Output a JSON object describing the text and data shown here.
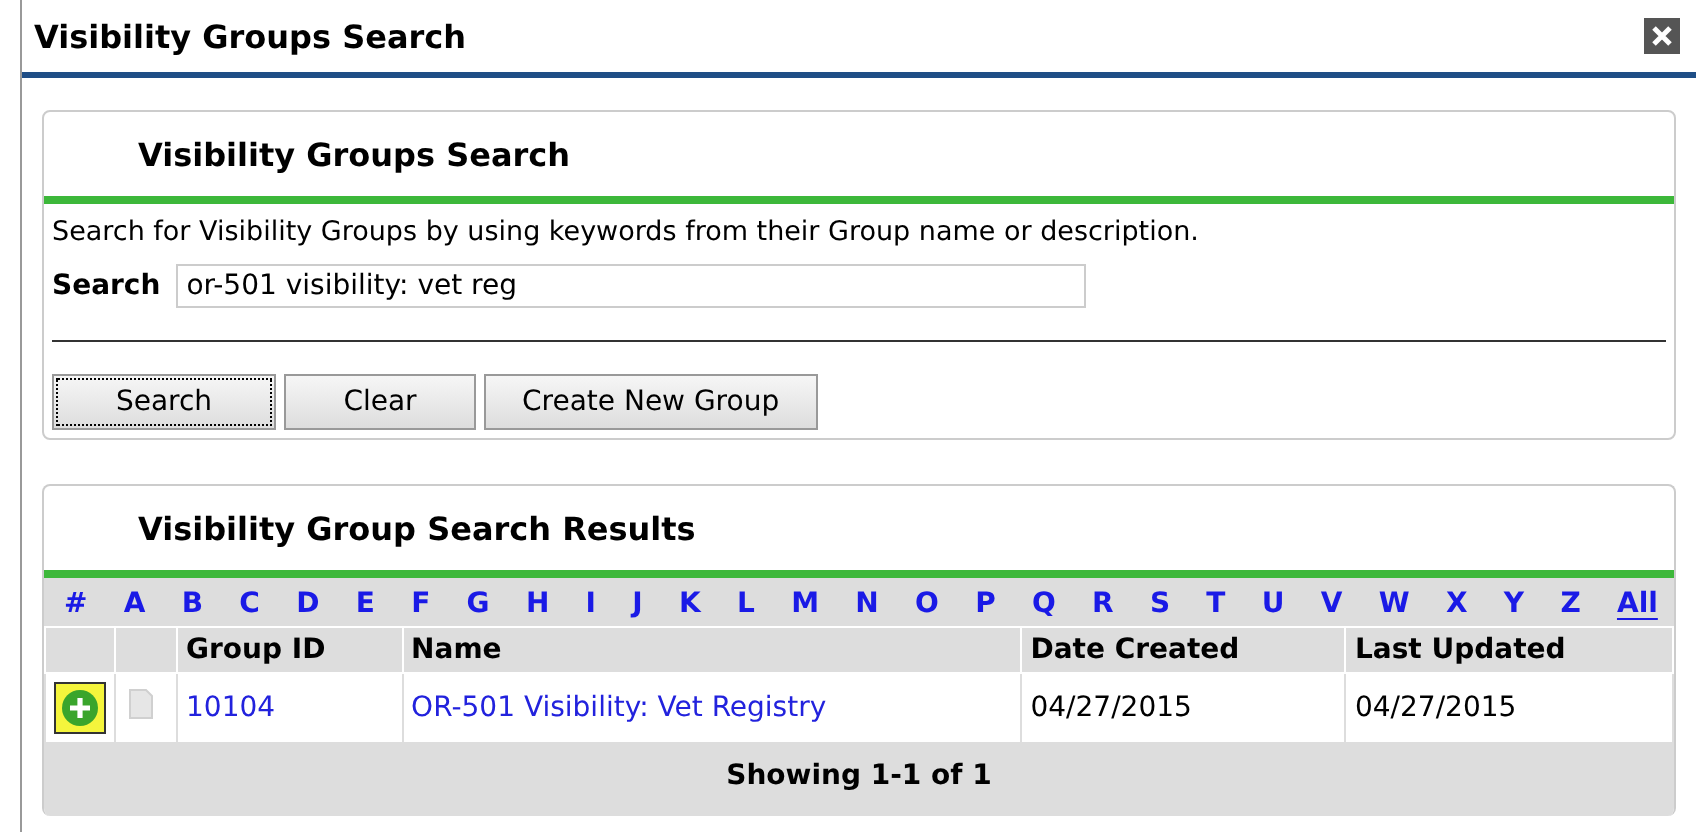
{
  "window": {
    "title": "Visibility Groups Search"
  },
  "search_panel": {
    "title": "Visibility Groups Search",
    "description": "Search for Visibility Groups by using keywords from their Group name or description.",
    "search_label": "Search",
    "search_value": "or-501 visibility: vet reg",
    "buttons": [
      {
        "label": "Search",
        "focused": true
      },
      {
        "label": "Clear",
        "focused": false
      },
      {
        "label": "Create New Group",
        "focused": false
      }
    ]
  },
  "results_panel": {
    "title": "Visibility Group Search Results",
    "letters": [
      {
        "label": "#",
        "selected": false
      },
      {
        "label": "A",
        "selected": false
      },
      {
        "label": "B",
        "selected": false
      },
      {
        "label": "C",
        "selected": false
      },
      {
        "label": "D",
        "selected": false
      },
      {
        "label": "E",
        "selected": false
      },
      {
        "label": "F",
        "selected": false
      },
      {
        "label": "G",
        "selected": false
      },
      {
        "label": "H",
        "selected": false
      },
      {
        "label": "I",
        "selected": false
      },
      {
        "label": "J",
        "selected": false
      },
      {
        "label": "K",
        "selected": false
      },
      {
        "label": "L",
        "selected": false
      },
      {
        "label": "M",
        "selected": false
      },
      {
        "label": "N",
        "selected": false
      },
      {
        "label": "O",
        "selected": false
      },
      {
        "label": "P",
        "selected": false
      },
      {
        "label": "Q",
        "selected": false
      },
      {
        "label": "R",
        "selected": false
      },
      {
        "label": "S",
        "selected": false
      },
      {
        "label": "T",
        "selected": false
      },
      {
        "label": "U",
        "selected": false
      },
      {
        "label": "V",
        "selected": false
      },
      {
        "label": "W",
        "selected": false
      },
      {
        "label": "X",
        "selected": false
      },
      {
        "label": "Y",
        "selected": false
      },
      {
        "label": "Z",
        "selected": false
      },
      {
        "label": "All",
        "selected": true
      }
    ],
    "columns": [
      "Group ID",
      "Name",
      "Date Created",
      "Last Updated"
    ],
    "rows": [
      {
        "group_id": "10104",
        "name": "OR-501 Visibility: Vet Registry",
        "date_created": "04/27/2015",
        "last_updated": "04/27/2015",
        "highlighted": true
      }
    ],
    "footer": "Showing 1-1 of 1"
  }
}
